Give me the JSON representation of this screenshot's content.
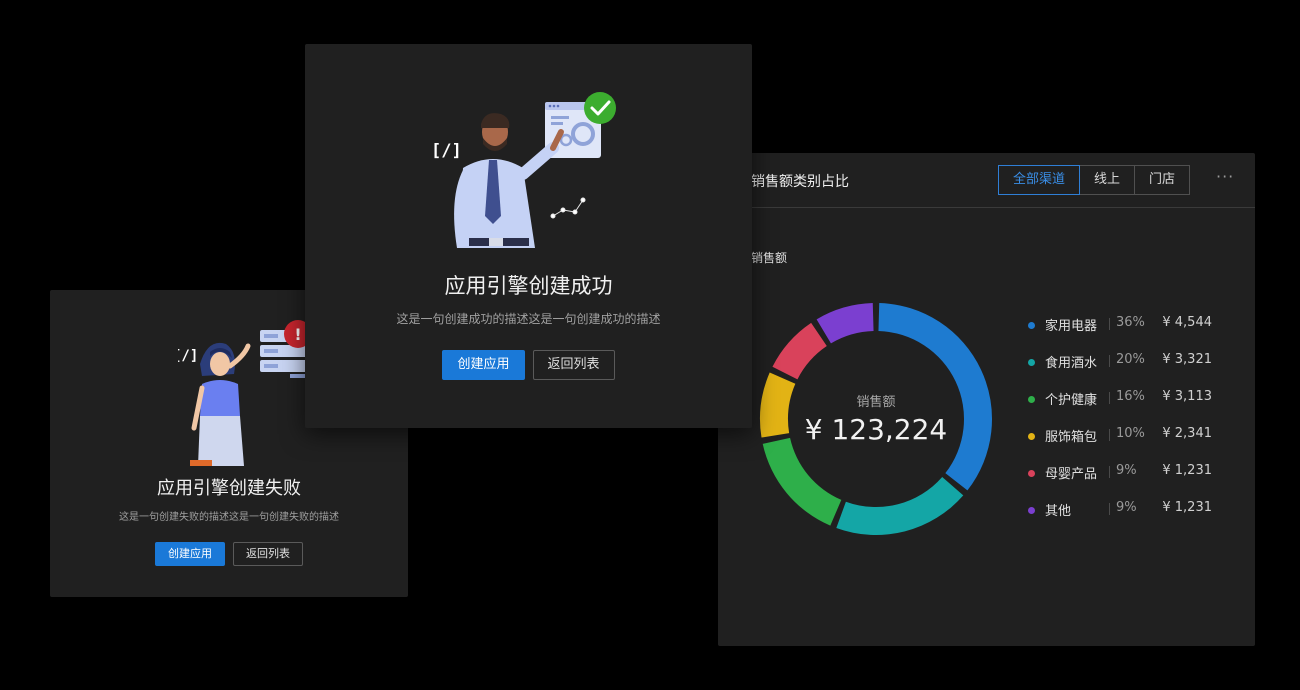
{
  "fail_card": {
    "title": "应用引擎创建失败",
    "description": "这是一句创建失败的描述这是一句创建失败的描述",
    "primary_button": "创建应用",
    "secondary_button": "返回列表",
    "code_glyph": "[/]",
    "badge_glyph": "!"
  },
  "success_card": {
    "title": "应用引擎创建成功",
    "description": "这是一句创建成功的描述这是一句创建成功的描述",
    "primary_button": "创建应用",
    "secondary_button": "返回列表",
    "code_glyph": "[/]"
  },
  "sales_card": {
    "title": "销售额类别占比",
    "tabs": [
      {
        "label": "全部渠道",
        "active": true
      },
      {
        "label": "线上",
        "active": false
      },
      {
        "label": "门店",
        "active": false
      }
    ],
    "more_label": "···",
    "subtitle": "销售额",
    "center_label": "销售额",
    "center_value": "¥ 123,224",
    "legend": [
      {
        "name": "家用电器",
        "percent": "36%",
        "amount": "¥ 4,544",
        "color": "#1e7bd0"
      },
      {
        "name": "食用酒水",
        "percent": "20%",
        "amount": "¥ 3,321",
        "color": "#14a6a6"
      },
      {
        "name": "个护健康",
        "percent": "16%",
        "amount": "¥ 3,113",
        "color": "#2eaf4a"
      },
      {
        "name": "服饰箱包",
        "percent": "10%",
        "amount": "¥ 2,341",
        "color": "#e2b315"
      },
      {
        "name": "母婴产品",
        "percent": "9%",
        "amount": "¥ 1,231",
        "color": "#d9425b"
      },
      {
        "name": "其他",
        "percent": "9%",
        "amount": "¥ 1,231",
        "color": "#7b3fd0"
      }
    ]
  },
  "colors": {
    "accent": "#1a79d8",
    "success": "#3cad2f",
    "error": "#c8252e",
    "card_bg": "#202020"
  }
}
